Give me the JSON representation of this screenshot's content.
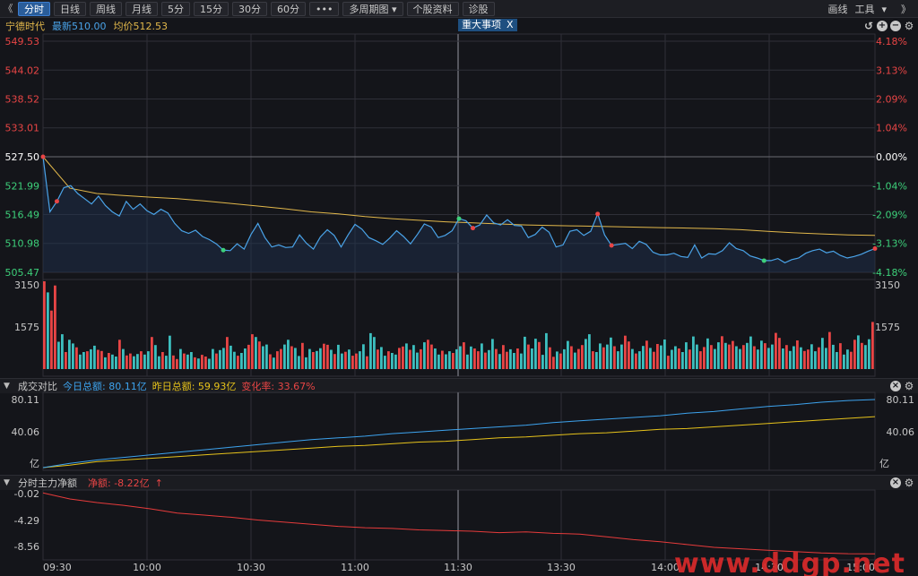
{
  "toolbar": {
    "nav_back": "《",
    "periods": [
      "分时",
      "日线",
      "周线",
      "月线",
      "5分",
      "15分",
      "30分",
      "60分"
    ],
    "active_period": "分时",
    "more": "•••",
    "multi_period": "多周期图",
    "dropdown_arrow": "▾",
    "stock_info": "个股资料",
    "diagnose": "诊股",
    "draw": "画线",
    "tools": "工具",
    "nav_forward": "》"
  },
  "info": {
    "stock_name": "宁德时代",
    "latest": "最新510.00",
    "avg": "均价512.53",
    "event_tag": "重大事项",
    "event_close": "X"
  },
  "sub1": {
    "title": "成交对比",
    "today_label": "今日总额: 80.11亿",
    "yesterday_label": "昨日总额: 59.93亿",
    "change_label": "变化率: 33.67%"
  },
  "sub2": {
    "title": "分时主力净额",
    "net_label": "净额: -8.22亿",
    "arrow": "↑"
  },
  "watermark": "www.ddgp.net",
  "colors": {
    "price": "#4aa3e8",
    "avg": "#e2b84b",
    "up": "#e84545",
    "down": "#3dbfbf",
    "today": "#3da3ee",
    "yesterday": "#e6c21a",
    "net": "#e63b3b",
    "grid": "#2f3038"
  },
  "chart_data": [
    {
      "type": "line",
      "title": "宁德时代",
      "x_ticks": [
        "09:30",
        "10:00",
        "10:30",
        "11:00",
        "11:30",
        "13:30",
        "14:00",
        "14:30",
        "15:00"
      ],
      "y_ticks_price": [
        "549.53",
        "544.02",
        "538.52",
        "533.01",
        "527.50",
        "521.99",
        "516.49",
        "510.98",
        "505.47"
      ],
      "y_ticks_pct": [
        "4.18%",
        "3.13%",
        "2.09%",
        "1.04%",
        "0.00%",
        "-1.04%",
        "-2.09%",
        "-3.13%",
        "-4.18%"
      ],
      "ylim": [
        505.47,
        549.53
      ],
      "prev_close": 527.5,
      "series": [
        {
          "name": "最新",
          "values": [
            527.5,
            517,
            519,
            521.6,
            522,
            520.5,
            519.5,
            518.5,
            520,
            518.2,
            517,
            516.2,
            519,
            517.5,
            518.5,
            517.2,
            516.5,
            517.5,
            516.8,
            514.8,
            513.4,
            512.9,
            513.5,
            512.3,
            511.7,
            510.9,
            509.7,
            509.6,
            510.9,
            509.9,
            512.7,
            514.8,
            512.1,
            510.3,
            510.7,
            510.2,
            510.3,
            512.6,
            511,
            509.9,
            512.2,
            513.6,
            512.5,
            510.3,
            512.6,
            514.6,
            513.7,
            512.1,
            511.5,
            510.8,
            512,
            513.4,
            512.3,
            510.9,
            512.7,
            514.7,
            514.1,
            512.1,
            512.5,
            513.4,
            515.7,
            515.3,
            513.9,
            514.5,
            516.4,
            514.9,
            514.5,
            515.5,
            514.4,
            514.3,
            512.1,
            512.7,
            514.1,
            513.1,
            510.3,
            510.7,
            513.3,
            513.6,
            512.5,
            513.3,
            516.6,
            512.6,
            510.6,
            510.8,
            511,
            510,
            511.4,
            510.8,
            509.3,
            508.8,
            508.8,
            509.1,
            508.5,
            508.3,
            510.7,
            508.2,
            509,
            508.9,
            509.6,
            511.1,
            510,
            509.6,
            508.6,
            508.2,
            507.7,
            507.7,
            508.1,
            507.3,
            507.9,
            508.2,
            509.1,
            509.6,
            509.9,
            509.2,
            509.5,
            508.7,
            508.2,
            508.5,
            508.9,
            509.5,
            510
          ]
        },
        {
          "name": "均价",
          "values": [
            527.5,
            521.5,
            520.5,
            520.1,
            519.8,
            519.5,
            519.1,
            518.6,
            518.1,
            517.6,
            517.0,
            516.6,
            516.1,
            515.7,
            515.4,
            515.1,
            514.9,
            514.7,
            514.5,
            514.4,
            514.3,
            514.2,
            514.1,
            514.0,
            513.9,
            513.8,
            513.6,
            513.3,
            513.0,
            512.8,
            512.6,
            512.53
          ]
        }
      ]
    },
    {
      "type": "bar",
      "title": "成交量",
      "y_ticks": [
        "3150",
        "1575"
      ],
      "ylim": [
        0,
        3150
      ],
      "values": [
        3150,
        2750,
        2100,
        3000,
        980,
        1250,
        610,
        1050,
        920,
        780,
        520,
        610,
        640,
        710,
        840,
        690,
        650,
        420,
        580,
        520,
        450,
        1050,
        720,
        490,
        560,
        460,
        540,
        640,
        520,
        640,
        1150,
        860,
        460,
        610,
        480,
        1200,
        490,
        360,
        720,
        560,
        520,
        610,
        420,
        380,
        510,
        450,
        370,
        720,
        560,
        680,
        760,
        1150,
        840,
        620,
        480,
        580,
        740,
        870,
        1250,
        1150,
        990,
        820,
        880,
        530,
        410,
        640,
        720,
        880,
        1050,
        820,
        760,
        470,
        940,
        420,
        720,
        610,
        650,
        750,
        910,
        870,
        690,
        540,
        870,
        560,
        620,
        700,
        480,
        560,
        640,
        890,
        460,
        1290,
        1150,
        700,
        790,
        480,
        640,
        580,
        520,
        760,
        810,
        920,
        690,
        860,
        590,
        710,
        960,
        1050,
        880,
        740,
        520,
        660,
        530,
        640,
        580,
        710,
        820,
        960,
        520,
        810,
        740,
        640,
        920,
        590,
        680,
        1080,
        720,
        540,
        860,
        620,
        710,
        580,
        740,
        560,
        1160,
        880,
        740,
        1090,
        970,
        510,
        1290,
        780,
        440,
        630,
        560,
        710,
        1010,
        820,
        590,
        720,
        860,
        1080,
        1250,
        640,
        610,
        920,
        780,
        880,
        1130,
        820,
        640,
        880,
        1200,
        990,
        720,
        560,
        640,
        830,
        1020,
        760,
        620,
        900,
        850,
        1060,
        480,
        690,
        820,
        740,
        610,
        960,
        700,
        1170,
        880,
        640,
        790,
        1100,
        860,
        720,
        960,
        1180,
        940,
        880,
        1010,
        820,
        720,
        860,
        940,
        1170,
        820,
        700,
        1020,
        930,
        760,
        880,
        1300,
        1120,
        740,
        860,
        650,
        820,
        1030,
        780,
        650,
        700,
        890,
        640,
        780,
        1120,
        760,
        1330,
        870,
        610,
        930,
        520,
        700,
        620,
        1050,
        1210,
        940,
        860,
        1070,
        1690
      ]
    },
    {
      "type": "line",
      "title": "成交对比",
      "y_ticks": [
        "80.11",
        "40.06",
        "亿"
      ],
      "ylim": [
        0,
        80.11
      ],
      "series": [
        {
          "name": "今日总额",
          "values": [
            0,
            5,
            9,
            12,
            15,
            18,
            21,
            24,
            27,
            30,
            33,
            35,
            37,
            40,
            42,
            44,
            46,
            48,
            50,
            53,
            55,
            57,
            59,
            61,
            64,
            66,
            69,
            72,
            74,
            77,
            79,
            80.11
          ]
        },
        {
          "name": "昨日总额",
          "values": [
            0,
            3,
            7,
            9,
            11,
            13,
            15,
            17,
            19,
            21,
            23,
            25,
            26,
            28,
            30,
            31,
            33,
            35,
            36,
            38,
            40,
            41,
            43,
            45,
            46,
            48,
            50,
            52,
            54,
            56,
            58,
            59.93
          ]
        }
      ]
    },
    {
      "type": "line",
      "title": "分时主力净额",
      "y_ticks": [
        "-0.02",
        "-4.29",
        "-8.56"
      ],
      "ylim": [
        -9.2,
        0
      ],
      "series": [
        {
          "name": "净额",
          "values": [
            -0.02,
            -0.9,
            -1.4,
            -1.8,
            -2.3,
            -2.9,
            -3.2,
            -3.5,
            -3.9,
            -4.2,
            -4.5,
            -4.8,
            -5.0,
            -5.1,
            -5.3,
            -5.4,
            -5.5,
            -5.7,
            -5.6,
            -5.8,
            -5.9,
            -6.3,
            -6.7,
            -7.0,
            -7.4,
            -7.8,
            -8.0,
            -8.2,
            -8.4,
            -8.6,
            -8.7,
            -8.72
          ]
        }
      ]
    }
  ]
}
